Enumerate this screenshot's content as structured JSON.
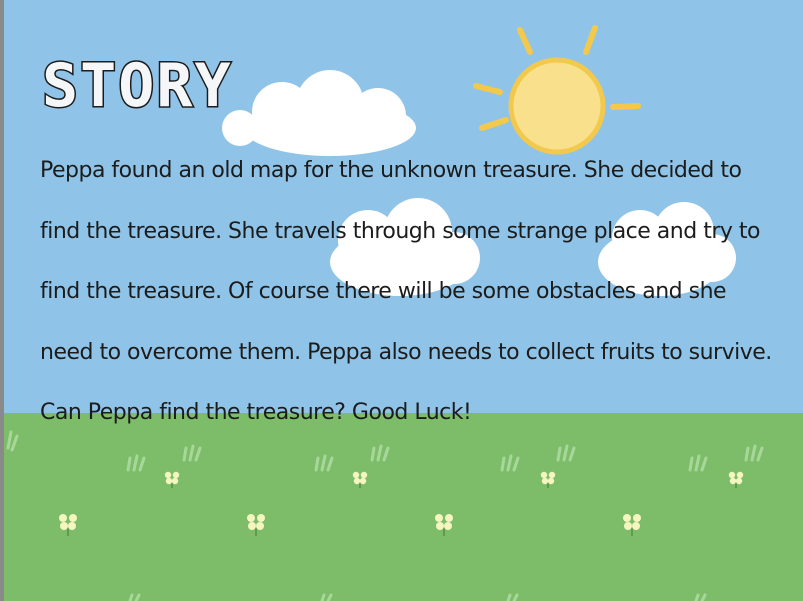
{
  "scene": {
    "title": "STORY",
    "lines": [
      "Peppa found an old map for the unknown treasure. She decided to",
      "find the treasure. She travels through some strange place and try to",
      "find the treasure. Of course there will be some obstacles and she",
      "need to overcome them. Peppa also needs to collect fruits to survive.",
      "Can Peppa find the treasure? Good Luck!"
    ]
  },
  "colors": {
    "sky": "#8fc4e8",
    "grass": "#7dbd6a",
    "sun": "#f9e08c",
    "sun_outline": "#f2c94c",
    "cloud": "#ffffff",
    "grass_tuft": "#a7d89a",
    "flower": "#f5f5c0"
  },
  "icons": [
    "sun-icon",
    "cloud-icon",
    "grass-tuft-icon",
    "flower-icon"
  ]
}
